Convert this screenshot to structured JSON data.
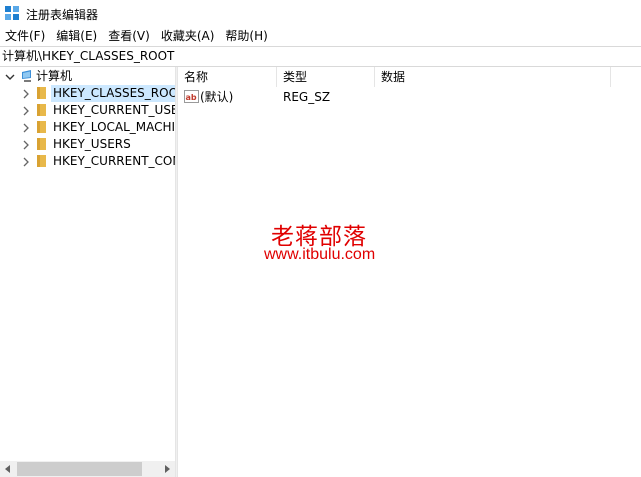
{
  "window": {
    "title": "注册表编辑器"
  },
  "menu": [
    "文件(F)",
    "编辑(E)",
    "查看(V)",
    "收藏夹(A)",
    "帮助(H)"
  ],
  "address": "计算机\\HKEY_CLASSES_ROOT",
  "tree": {
    "root": "计算机",
    "children": [
      {
        "label": "HKEY_CLASSES_ROOT",
        "selected": true
      },
      {
        "label": "HKEY_CURRENT_USER",
        "selected": false
      },
      {
        "label": "HKEY_LOCAL_MACHINE",
        "selected": false
      },
      {
        "label": "HKEY_USERS",
        "selected": false
      },
      {
        "label": "HKEY_CURRENT_CONFIG",
        "selected": false
      }
    ]
  },
  "list": {
    "columns": [
      "名称",
      "类型",
      "数据"
    ],
    "rows": [
      {
        "name": "(默认)",
        "type": "REG_SZ",
        "data": ""
      }
    ]
  },
  "watermark": {
    "text": "老蒋部落",
    "url": "www.itbulu.com",
    "color": "#e00000"
  },
  "colors": {
    "selection": "#cce8ff",
    "folder": "#e8b84a",
    "scrollbar": "#f0f0f0"
  },
  "icons": {
    "app": "registry-editor-icon",
    "computer": "computer-icon",
    "folder": "folder-icon",
    "value": "string-value-icon"
  }
}
